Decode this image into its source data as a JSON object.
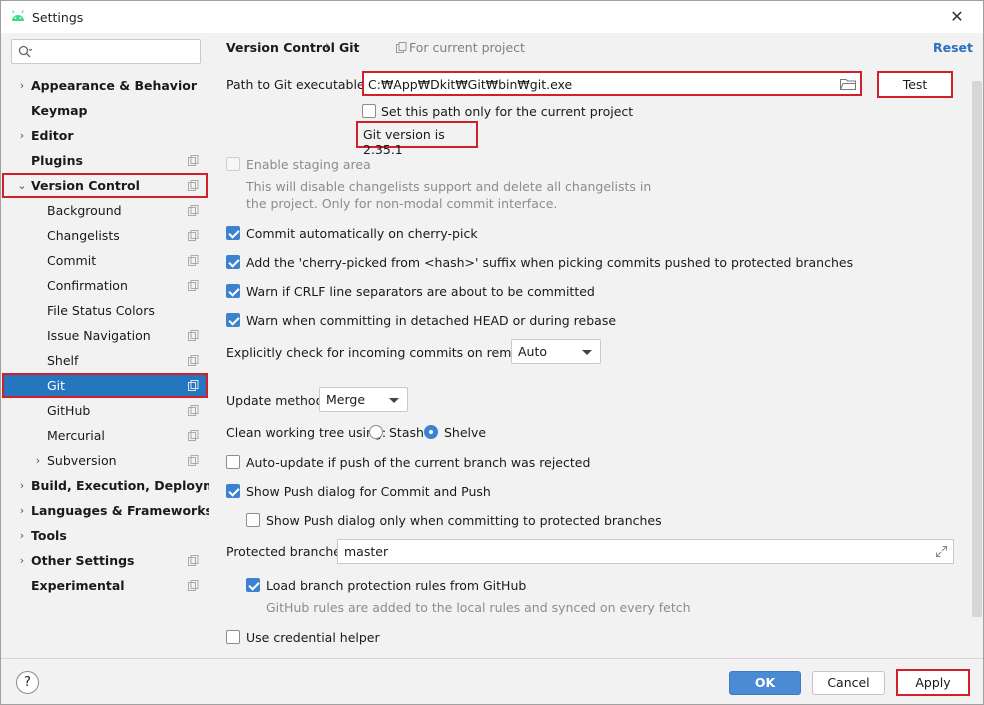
{
  "window": {
    "title": "Settings",
    "close": "✕"
  },
  "search": {
    "placeholder": ""
  },
  "sidebar": {
    "items": [
      {
        "label": "Appearance & Behavior",
        "bold": true,
        "arrow": "›",
        "copy": false
      },
      {
        "label": "Keymap",
        "bold": true,
        "arrow": "",
        "copy": false
      },
      {
        "label": "Editor",
        "bold": true,
        "arrow": "›",
        "copy": false
      },
      {
        "label": "Plugins",
        "bold": true,
        "arrow": "",
        "copy": true
      },
      {
        "label": "Version Control",
        "bold": true,
        "arrow": "⌄",
        "copy": true,
        "expanded": true
      },
      {
        "label": "Background",
        "bold": false,
        "copy": true
      },
      {
        "label": "Changelists",
        "bold": false,
        "copy": true
      },
      {
        "label": "Commit",
        "bold": false,
        "copy": true
      },
      {
        "label": "Confirmation",
        "bold": false,
        "copy": true
      },
      {
        "label": "File Status Colors",
        "bold": false,
        "copy": false
      },
      {
        "label": "Issue Navigation",
        "bold": false,
        "copy": true
      },
      {
        "label": "Shelf",
        "bold": false,
        "copy": true
      },
      {
        "label": "Git",
        "bold": false,
        "copy": true,
        "selected": true
      },
      {
        "label": "GitHub",
        "bold": false,
        "copy": true
      },
      {
        "label": "Mercurial",
        "bold": false,
        "copy": true
      },
      {
        "label": "Subversion",
        "bold": false,
        "arrow": "›",
        "copy": true
      },
      {
        "label": "Build, Execution, Deployment",
        "bold": true,
        "arrow": "›",
        "copy": false
      },
      {
        "label": "Languages & Frameworks",
        "bold": true,
        "arrow": "›",
        "copy": false
      },
      {
        "label": "Tools",
        "bold": true,
        "arrow": "›",
        "copy": false
      },
      {
        "label": "Other Settings",
        "bold": true,
        "arrow": "›",
        "copy": true
      },
      {
        "label": "Experimental",
        "bold": true,
        "arrow": "",
        "copy": true
      }
    ]
  },
  "breadcrumb": {
    "parent": "Version Control",
    "separator": "›",
    "current": "Git",
    "scope": "For current project"
  },
  "reset_label": "Reset",
  "git": {
    "path_label": "Path to Git executable:",
    "path_value": "C:₩App₩Dkit₩Git₩bin₩git.exe",
    "test_label": "Test",
    "project_only_label": "Set this path only for the current project",
    "version_text": "Git version is 2.35.1",
    "staging_label": "Enable staging area",
    "staging_note_1": "This will disable changelists support and delete all changelists in",
    "staging_note_2": "the project. Only for non-modal commit interface.",
    "commit_cherry_label": "Commit automatically on cherry-pick",
    "cherry_suffix_label": "Add the 'cherry-picked from <hash>' suffix when picking commits pushed to protected branches",
    "crlf_label": "Warn if CRLF line separators are about to be committed",
    "detached_label": "Warn when committing in detached HEAD or during rebase",
    "incoming_label": "Explicitly check for incoming commits on remotes:",
    "incoming_value": "Auto",
    "update_method_label": "Update method:",
    "update_method_value": "Merge",
    "clean_tree_label": "Clean working tree using:",
    "stash_label": "Stash",
    "shelve_label": "Shelve",
    "auto_update_label": "Auto-update if push of the current branch was rejected",
    "show_push_label": "Show Push dialog for Commit and Push",
    "show_push_protected_label": "Show Push dialog only when committing to protected branches",
    "protected_label": "Protected branches:",
    "protected_value": "master",
    "load_rules_label": "Load branch protection rules from GitHub",
    "load_rules_note": "GitHub rules are added to the local rules and synced on every fetch",
    "credential_label": "Use credential helper"
  },
  "footer": {
    "help": "?",
    "ok": "OK",
    "cancel": "Cancel",
    "apply": "Apply"
  },
  "colors": {
    "accent": "#2675bf",
    "highlight_box": "#d0202c",
    "link": "#2b6fc2"
  }
}
